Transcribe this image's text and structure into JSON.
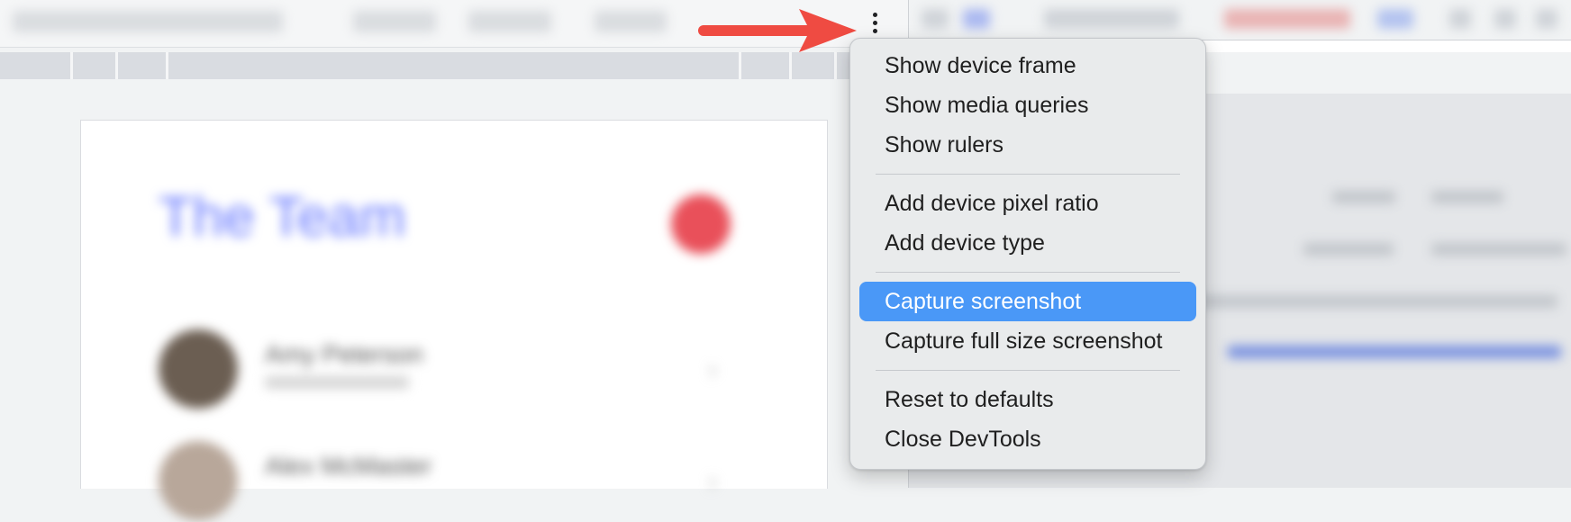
{
  "colors": {
    "accent_highlight": "#4a98f7",
    "menu_background": "#e9ebec",
    "arrow": "#ef4b42"
  },
  "device_toolbar": {
    "more_options_icon": "vertical-ellipsis-icon"
  },
  "context_menu": {
    "groups": [
      [
        {
          "label": "Show device frame"
        },
        {
          "label": "Show media queries"
        },
        {
          "label": "Show rulers"
        }
      ],
      [
        {
          "label": "Add device pixel ratio"
        },
        {
          "label": "Add device type"
        }
      ],
      [
        {
          "label": "Capture screenshot",
          "selected": true
        },
        {
          "label": "Capture full size screenshot"
        }
      ],
      [
        {
          "label": "Reset to defaults"
        },
        {
          "label": "Close DevTools"
        }
      ]
    ]
  }
}
